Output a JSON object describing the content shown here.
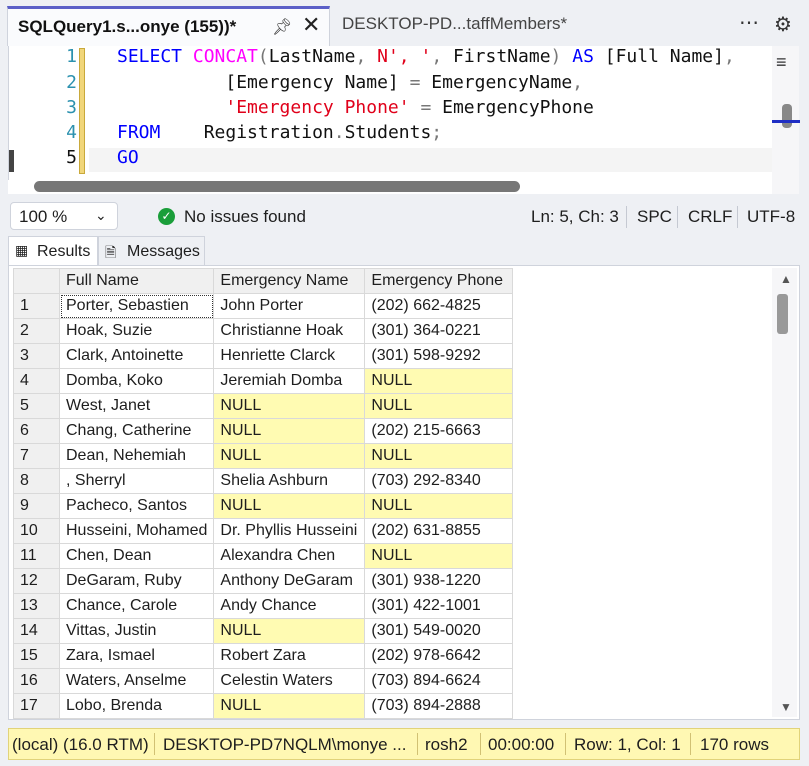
{
  "tabs": {
    "active_title": "SQLQuery1.s...onye (155))*",
    "inactive_title": "DESKTOP-PD...taffMembers*",
    "pin_icon": "pin-icon",
    "close_icon": "close-icon",
    "overflow_icon": "more-icon",
    "settings_icon": "gear-icon"
  },
  "editor": {
    "line_numbers": [
      "1",
      "2",
      "3",
      "4",
      "5"
    ],
    "lines": [
      [
        {
          "t": "SELECT ",
          "c": "kw"
        },
        {
          "t": "CONCAT",
          "c": "fn"
        },
        {
          "t": "(",
          "c": "gr"
        },
        {
          "t": "LastName",
          "c": ""
        },
        {
          "t": ", ",
          "c": "gr"
        },
        {
          "t": "N', '",
          "c": "str"
        },
        {
          "t": ", ",
          "c": "gr"
        },
        {
          "t": "FirstName",
          "c": ""
        },
        {
          "t": ") ",
          "c": "gr"
        },
        {
          "t": "AS ",
          "c": "kw"
        },
        {
          "t": "[Full Name]",
          "c": ""
        },
        {
          "t": ",",
          "c": "gr"
        }
      ],
      [
        {
          "t": "          [Emergency Name] ",
          "c": ""
        },
        {
          "t": "=",
          "c": "gr"
        },
        {
          "t": " EmergencyName",
          "c": ""
        },
        {
          "t": ",",
          "c": "gr"
        }
      ],
      [
        {
          "t": "          ",
          "c": ""
        },
        {
          "t": "'Emergency Phone'",
          "c": "str"
        },
        {
          "t": " ",
          "c": ""
        },
        {
          "t": "=",
          "c": "gr"
        },
        {
          "t": " EmergencyPhone",
          "c": ""
        }
      ],
      [
        {
          "t": "FROM",
          "c": "kw"
        },
        {
          "t": "    Registration",
          "c": ""
        },
        {
          "t": ".",
          "c": "gr"
        },
        {
          "t": "Students",
          "c": ""
        },
        {
          "t": ";",
          "c": "gr"
        }
      ],
      [
        {
          "t": "GO",
          "c": "kw"
        }
      ]
    ]
  },
  "editor_status": {
    "zoom": "100 %",
    "issues": "No issues found",
    "position": "Ln: 5, Ch: 3",
    "whitespace": "SPC",
    "line_ending": "CRLF",
    "encoding": "UTF-8"
  },
  "result_tabs": {
    "results_label": "Results",
    "messages_label": "Messages"
  },
  "grid": {
    "columns": [
      "Full Name",
      "Emergency Name",
      "Emergency Phone"
    ],
    "rows": [
      [
        "1",
        "Porter, Sebastien",
        "John Porter",
        "(202) 662-4825"
      ],
      [
        "2",
        "Hoak, Suzie",
        "Christianne Hoak",
        "(301) 364-0221"
      ],
      [
        "3",
        "Clark, Antoinette",
        "Henriette Clarck",
        "(301) 598-9292"
      ],
      [
        "4",
        "Domba, Koko",
        "Jeremiah Domba",
        "NULL"
      ],
      [
        "5",
        "West, Janet",
        "NULL",
        "NULL"
      ],
      [
        "6",
        "Chang, Catherine",
        "NULL",
        "(202) 215-6663"
      ],
      [
        "7",
        "Dean, Nehemiah",
        "NULL",
        "NULL"
      ],
      [
        "8",
        ", Sherryl",
        "Shelia Ashburn",
        "(703) 292-8340"
      ],
      [
        "9",
        "Pacheco, Santos",
        "NULL",
        "NULL"
      ],
      [
        "10",
        "Husseini, Mohamed",
        "Dr. Phyllis Husseini",
        "(202) 631-8855"
      ],
      [
        "11",
        "Chen, Dean",
        "Alexandra Chen",
        "NULL"
      ],
      [
        "12",
        "DeGaram, Ruby",
        "Anthony DeGaram",
        "(301) 938-1220"
      ],
      [
        "13",
        "Chance, Carole",
        "Andy Chance",
        "(301) 422-1001"
      ],
      [
        "14",
        "Vittas, Justin",
        "NULL",
        "(301) 549-0020"
      ],
      [
        "15",
        "Zara, Ismael",
        "Robert Zara",
        "(202) 978-6642"
      ],
      [
        "16",
        "Waters, Anselme",
        "Celestin Waters",
        "(703) 894-6624"
      ],
      [
        "17",
        "Lobo, Brenda",
        "NULL",
        "(703) 894-2888"
      ]
    ]
  },
  "query_status": {
    "server": "(local) (16.0 RTM)",
    "login": "DESKTOP-PD7NQLM\\monye ...",
    "database": "rosh2",
    "elapsed": "00:00:00",
    "position": "Row: 1, Col: 1",
    "row_count": "170 rows"
  },
  "colors": {
    "status_bar": "#fff8b3",
    "null_cell": "#fffbb2",
    "keyword": "#0000ff",
    "function": "#ff00ff",
    "string": "#e0001a",
    "active_tab_accent": "#5b5fc7"
  }
}
